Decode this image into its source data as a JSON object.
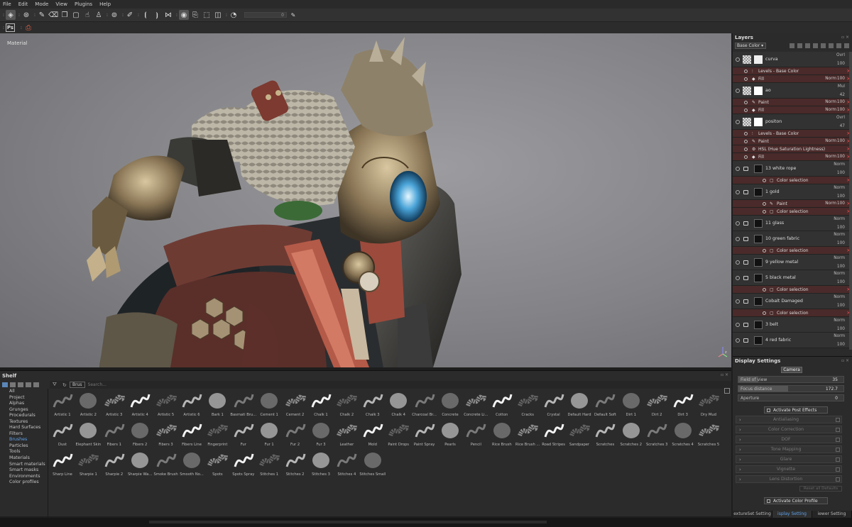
{
  "menu": [
    "File",
    "Edit",
    "Mode",
    "View",
    "Plugins",
    "Help"
  ],
  "toolbar": {
    "icons": [
      "paint-icon",
      "project-icon",
      "brush-icon",
      "eraser-icon",
      "projection-icon",
      "polyfill-icon",
      "smudge-icon",
      "clone-icon",
      "picker-icon",
      "material-picker-icon",
      "symmetry-icon",
      "symmetry-mirror-icon",
      "layout-icon",
      "camera-icon",
      "render-icon",
      "view-2d-icon",
      "screenshot-icon"
    ],
    "slider_value": "0"
  },
  "viewport": {
    "label": "Material"
  },
  "shelf": {
    "title": "Shelf",
    "search_tag": "Brus",
    "search_placeholder": "Search...",
    "categories": [
      "All",
      "Project",
      "Alphas",
      "Grunges",
      "Procedurals",
      "Textures",
      "Hard Surfaces",
      "Filters",
      "Brushes",
      "Particles",
      "Tools",
      "Materials",
      "Smart materials",
      "Smart masks",
      "Environments",
      "Color profiles"
    ],
    "active_category": "Brushes",
    "brushes": [
      "Artistic 1",
      "Artistic 2",
      "Artistic 3",
      "Artistic 4",
      "Artistic 5",
      "Artistic 6",
      "Bark 1",
      "Basmati Bru...",
      "Cement 1",
      "Cement 2",
      "Chalk 1",
      "Chalk 2",
      "Chalk 3",
      "Chalk 4",
      "Charcoal Br...",
      "Concrete",
      "Concrete Li...",
      "Cotton",
      "Cracks",
      "Crystal",
      "Default Hard",
      "Default Soft",
      "Dirt 1",
      "Dirt 2",
      "Dirt 3",
      "Dry Mud",
      "Dust",
      "Elephant Skin",
      "Fibers 1",
      "Fibers 2",
      "Fibers 3",
      "Fibers Line",
      "Fingerprint",
      "Fur",
      "Fur 1",
      "Fur 2",
      "Fur 3",
      "Leather",
      "Mold",
      "Paint Drops",
      "Paint Spray",
      "Pearls",
      "Pencil",
      "Rice Brush",
      "Rice Brush ...",
      "Road Stripes",
      "Sandpaper",
      "Scratches",
      "Scratches 2",
      "Scratches 3",
      "Scratches 4",
      "Scratches 5",
      "Sharp Line",
      "Sharpie 1",
      "Sharpie 2",
      "Sharpie Wa...",
      "Smoke Brush",
      "Smooth No...",
      "Spots",
      "Spots Spray",
      "Stitches 1",
      "Stitches 2",
      "Stitches 3",
      "Stitches 4",
      "Stitches Small"
    ]
  },
  "layers": {
    "title": "Layers",
    "channel": "Base Color",
    "rows": [
      {
        "kind": "layer",
        "name": "curva",
        "blend": "Ovrl",
        "opacity": "100",
        "eye": "off"
      },
      {
        "kind": "fx",
        "name": "Levels - Base Color",
        "blend": "",
        "opacity": "",
        "icon": "levels"
      },
      {
        "kind": "fx",
        "name": "Fill",
        "blend": "Norm",
        "opacity": "100",
        "icon": "fill"
      },
      {
        "kind": "layer",
        "name": "ao",
        "blend": "Mul",
        "opacity": "42",
        "eye": "off"
      },
      {
        "kind": "fx",
        "name": "Paint",
        "blend": "Norm",
        "opacity": "100",
        "icon": "paint"
      },
      {
        "kind": "fx",
        "name": "Fill",
        "blend": "Norm",
        "opacity": "100",
        "icon": "fill"
      },
      {
        "kind": "layer",
        "name": "positon",
        "blend": "Ovrl",
        "opacity": "47",
        "eye": "on"
      },
      {
        "kind": "fx",
        "name": "Levels - Base Color",
        "blend": "",
        "opacity": "",
        "icon": "levels"
      },
      {
        "kind": "fx",
        "name": "Paint",
        "blend": "Norm",
        "opacity": "100",
        "icon": "paint"
      },
      {
        "kind": "fx",
        "name": "HSL (Hue Saturation Lightness)",
        "blend": "",
        "opacity": "",
        "icon": "hsl"
      },
      {
        "kind": "fx",
        "name": "Fill",
        "blend": "Norm",
        "opacity": "100",
        "icon": "fill"
      },
      {
        "kind": "folder",
        "name": "13 white rope",
        "blend": "Norm",
        "opacity": "100"
      },
      {
        "kind": "cs",
        "name": "Color selection"
      },
      {
        "kind": "folder",
        "name": "1 gold",
        "blend": "Norm",
        "opacity": "100"
      },
      {
        "kind": "cs",
        "name": "Paint",
        "blend": "Norm",
        "opacity": "100",
        "icon": "paint"
      },
      {
        "kind": "cs",
        "name": "Color selection"
      },
      {
        "kind": "folder",
        "name": "11 glass",
        "blend": "Norm",
        "opacity": "100"
      },
      {
        "kind": "folder",
        "name": "10 green fabric",
        "blend": "Norm",
        "opacity": "100"
      },
      {
        "kind": "cs",
        "name": "Color selection"
      },
      {
        "kind": "folder",
        "name": "9 yellow metal",
        "blend": "Norm",
        "opacity": "100"
      },
      {
        "kind": "folder",
        "name": "5 black metal",
        "blend": "Norm",
        "opacity": "100"
      },
      {
        "kind": "cs",
        "name": "Color selection"
      },
      {
        "kind": "folder",
        "name": "Cobalt Damaged",
        "blend": "Norm",
        "opacity": "100"
      },
      {
        "kind": "cs",
        "name": "Color selection"
      },
      {
        "kind": "folder",
        "name": "3 belt",
        "blend": "Norm",
        "opacity": "100"
      },
      {
        "kind": "folder",
        "name": "4 red fabric",
        "blend": "Norm",
        "opacity": "100"
      }
    ]
  },
  "display_settings": {
    "title": "Display Settings",
    "tab": "Camera",
    "fov_label": "Field of view",
    "fov_value": "35",
    "focus_label": "Focus distance",
    "focus_value": "172.7",
    "aperture_label": "Aperture",
    "aperture_value": "0",
    "post_effects": "Activate Post Effects",
    "sections": [
      "Antialiasing",
      "Color Correction",
      "DOF",
      "Tone Mapping",
      "Glare",
      "Vignette",
      "Lens Distortion"
    ],
    "reset": "Reset all Defaults",
    "color_profile": "Activate Color Profile"
  },
  "bottom_tabs": [
    "extureSet Setting",
    "isplay Setting",
    "iewer Setting"
  ],
  "active_bottom_tab": "isplay Setting",
  "colors": {
    "accent": "#5fa0e8",
    "fx_row": "#4a2a2a",
    "delete_x": "#e05050"
  }
}
